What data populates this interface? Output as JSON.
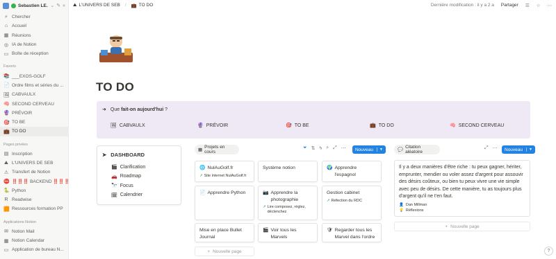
{
  "workspace": {
    "name": "Sebastien LE..."
  },
  "sidebar": {
    "top_items": [
      {
        "icon": "search-icon",
        "glyph": "⌕",
        "label": "Chercher"
      },
      {
        "icon": "home-icon",
        "glyph": "⌂",
        "label": "Accueil"
      },
      {
        "icon": "meetings-icon",
        "glyph": "▦",
        "label": "Réunions"
      },
      {
        "icon": "ai-icon",
        "glyph": "◎",
        "label": "IA de Notion"
      },
      {
        "icon": "inbox-icon",
        "glyph": "▭",
        "label": "Boîte de réception"
      }
    ],
    "favorites_header": "Favoris",
    "favorites": [
      {
        "glyph": "📚",
        "label": "___EXOS-GOLF"
      },
      {
        "glyph": "📄",
        "label": "Ordre films et séries du ..."
      },
      {
        "glyph": "🖼",
        "label": "CABVAULX"
      },
      {
        "glyph": "🧠",
        "label": "SECOND CERVEAU"
      },
      {
        "glyph": "🔮",
        "label": "PRÉVOIR"
      },
      {
        "glyph": "🎯",
        "label": "TO BE"
      },
      {
        "glyph": "💼",
        "label": "TO DO"
      }
    ],
    "private_header": "Pages privées",
    "private": [
      {
        "glyph": "▤",
        "label": "Inscription"
      },
      {
        "glyph": "⛰",
        "label": "L'UNIVERS DE SEB"
      },
      {
        "glyph": "⚠",
        "label": "Transfert de Notion"
      },
      {
        "glyph": "⛔",
        "label": "‼️‼️‼️ BACKEND ‼️‼️‼️..."
      },
      {
        "glyph": "🐍",
        "label": "Python"
      },
      {
        "glyph": "R",
        "label": "Readwise"
      },
      {
        "glyph": "🟧",
        "label": "Ressources formation PP"
      }
    ],
    "apps_header": "Applications Notion",
    "apps": [
      {
        "glyph": "✉",
        "label": "Notion Mail"
      },
      {
        "glyph": "▦",
        "label": "Notion Calendar"
      },
      {
        "glyph": "▭",
        "label": "Application de bureau N..."
      }
    ]
  },
  "topbar": {
    "crumb1": "L'UNIVERS DE SEB",
    "crumb2": "TO DO",
    "last_modified": "Dernière modification : il y a 2 a",
    "share": "Partager"
  },
  "page": {
    "title": "TO DO",
    "callout_prefix": "Que",
    "callout_bold": "fait-on aujourd'hui",
    "callout_suffix": " ?",
    "quick_links": [
      {
        "glyph": "🖼",
        "label": "CABVAULX"
      },
      {
        "glyph": "🔮",
        "label": "PRÉVOIR"
      },
      {
        "glyph": "🎯",
        "label": "TO BE"
      },
      {
        "glyph": "💼",
        "label": "TO DO"
      },
      {
        "glyph": "🧠",
        "label": "SECOND CERVEAU"
      }
    ]
  },
  "dashboard": {
    "title": "DASHBOARD",
    "items": [
      {
        "glyph": "🎬",
        "label": "Clarification"
      },
      {
        "glyph": "🚗",
        "label": "Roadmap"
      },
      {
        "glyph": "🔭",
        "label": "Focus"
      },
      {
        "glyph": "🗓",
        "label": "Calendrier"
      }
    ]
  },
  "projects": {
    "tab_label": "Projets en cours",
    "new_button": "Nouveau",
    "new_page": "Nouvelle page",
    "cards": [
      {
        "title": "NulAuGolf.fr",
        "prop": "Site internet NulAuGolf.fr"
      },
      {
        "title": "Système notion",
        "prop": ""
      },
      {
        "title": "Apprendre l'espagnol",
        "prop": ""
      },
      {
        "title": "Apprendre Python",
        "prop": ""
      },
      {
        "title": "Apprendre la photographie",
        "prop": "Lire composez, réglez, déclenchez"
      },
      {
        "title": "Gestion cabinet",
        "prop": "Réfection du RDC"
      },
      {
        "title": "Mise en place Bullet Journal",
        "prop": ""
      },
      {
        "title": "Voir tous les Marvels",
        "prop": ""
      },
      {
        "title": "Regarder tous les Marvel dans l'ordre",
        "prop": ""
      }
    ]
  },
  "quote": {
    "tab_label": "Citation aléatoire",
    "new_button": "Nouveau",
    "text": "Il y a deux manières d'être riche : tu peux gagner, hériter, emprunter, mendier ou voler assez d'argent pour assouvir des désirs coûteux, ou bien tu peux vivre une vie simple avec peu de désirs. De cette manière, tu as toujours plus d'argent qu'il ne t'en faut.",
    "author": "Dan Millman",
    "category": "Réflexions",
    "new_page": "Nouvelle page"
  },
  "help": "?"
}
